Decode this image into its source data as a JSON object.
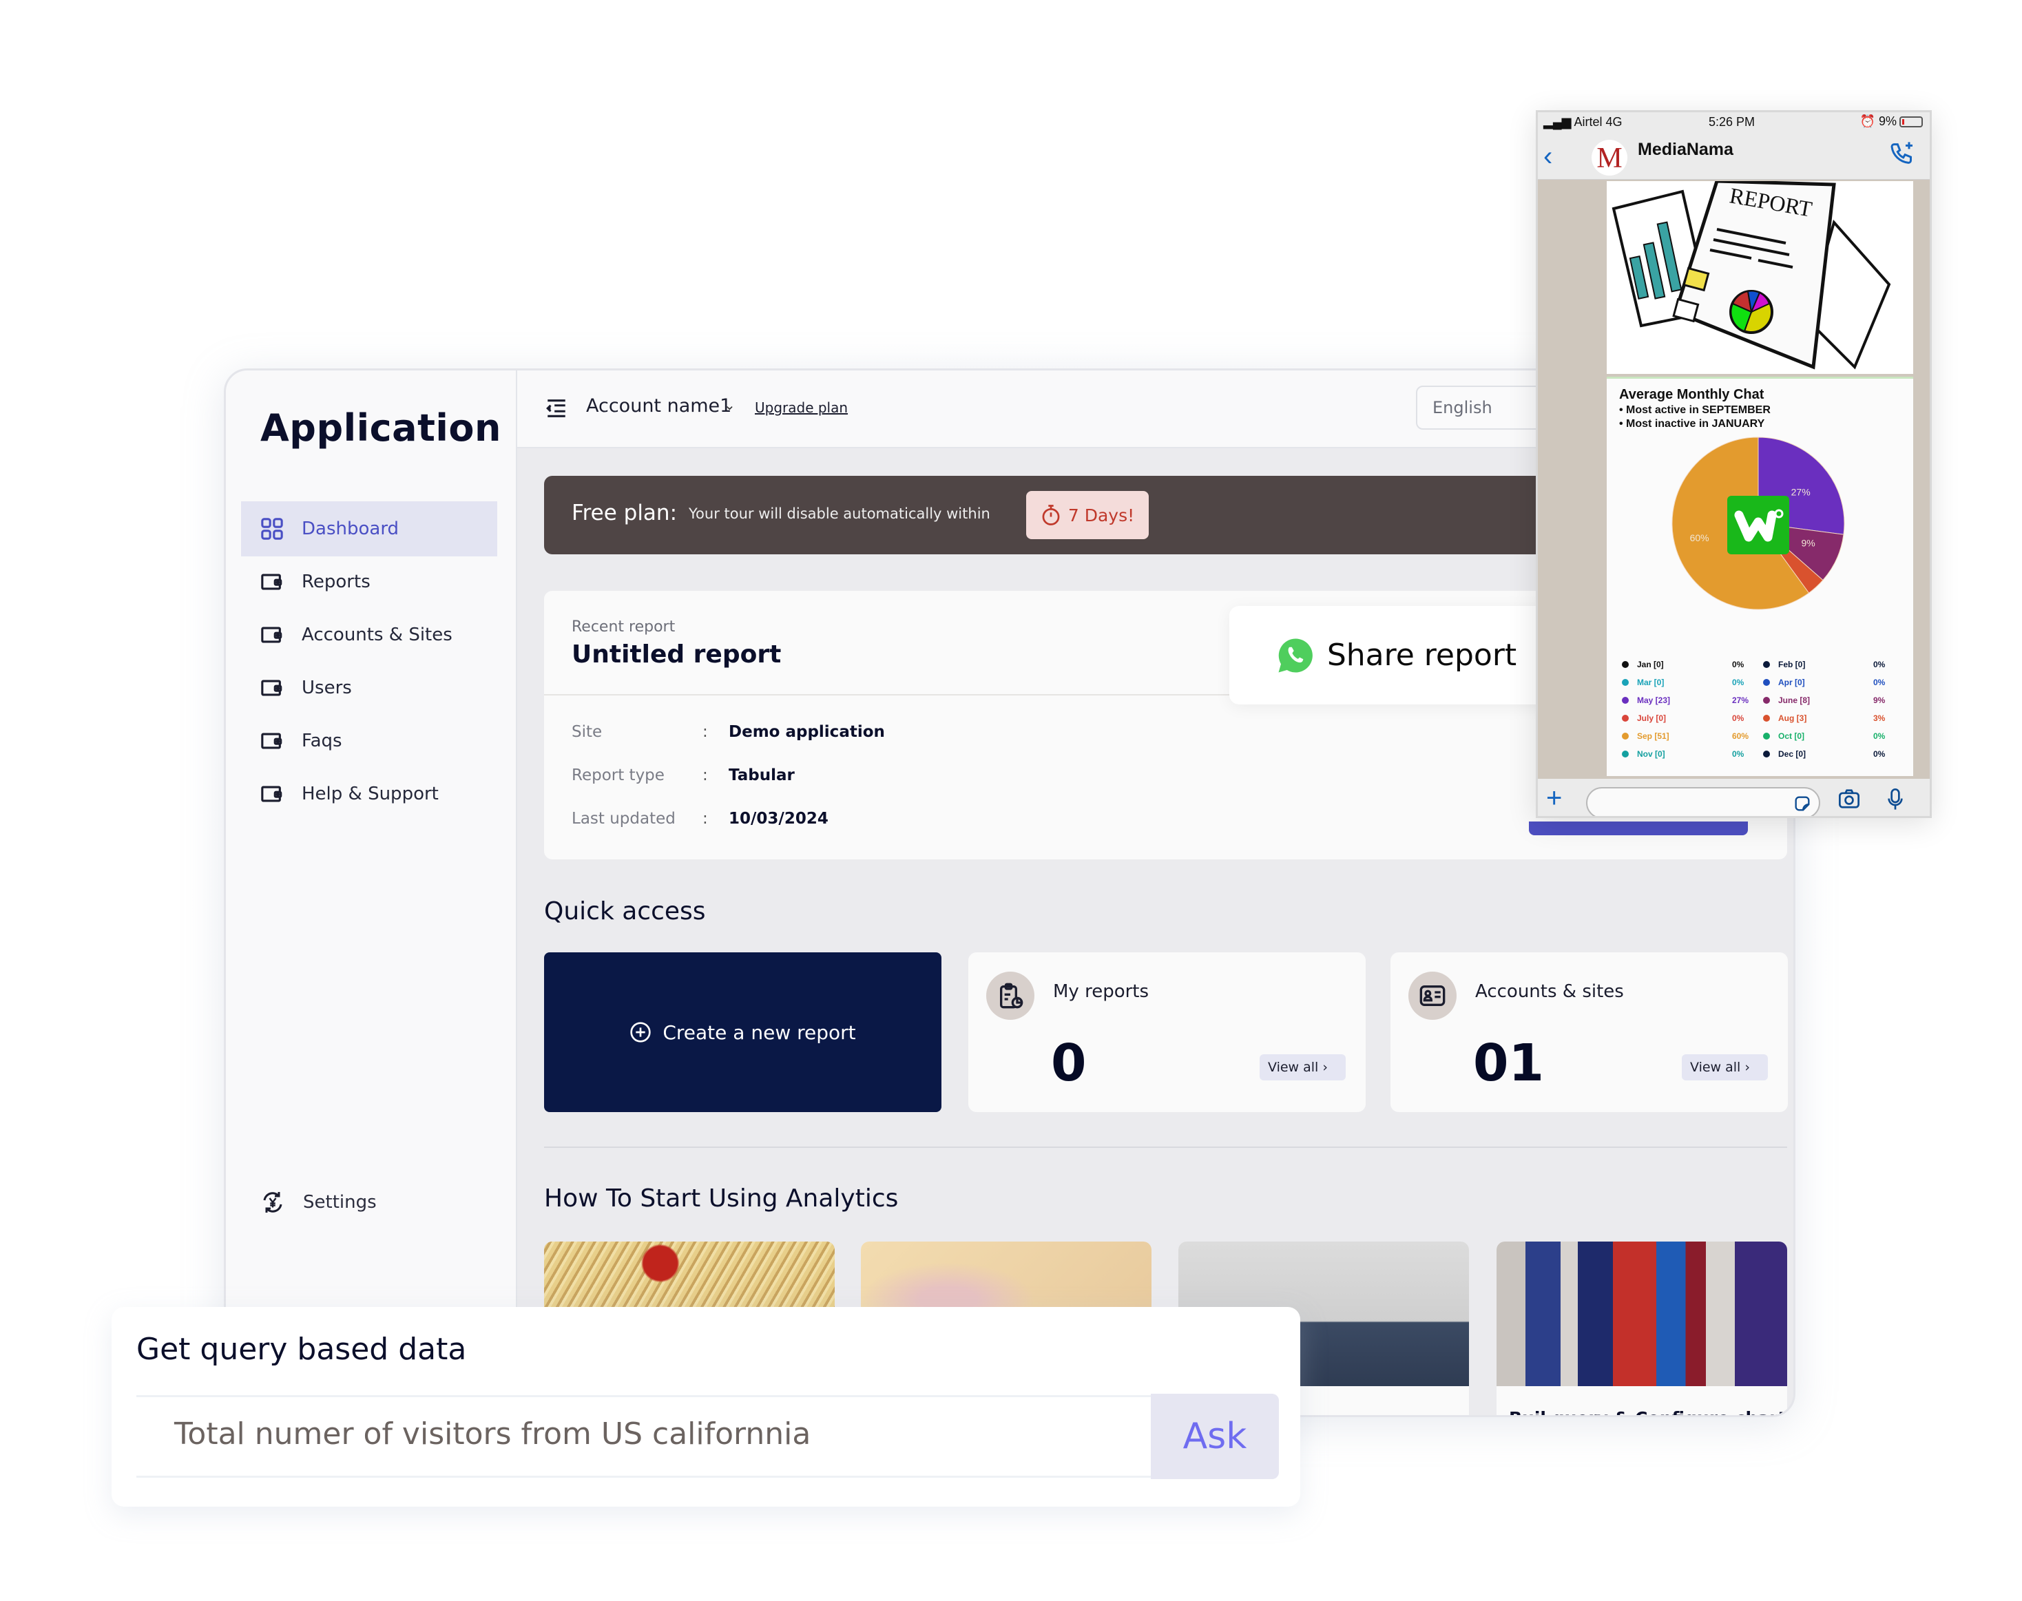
{
  "app": {
    "title": "Application",
    "sidebar": {
      "items": [
        {
          "label": "Dashboard",
          "icon": "grid-icon",
          "active": true
        },
        {
          "label": "Reports",
          "icon": "wallet-icon"
        },
        {
          "label": "Accounts & Sites",
          "icon": "wallet-icon"
        },
        {
          "label": "Users",
          "icon": "wallet-icon"
        },
        {
          "label": "Faqs",
          "icon": "wallet-icon"
        },
        {
          "label": "Help & Support",
          "icon": "wallet-icon"
        }
      ],
      "settings_label": "Settings"
    },
    "header": {
      "account_name": "Account name1",
      "upgrade_label": "Upgrade plan",
      "language": "English"
    },
    "banner": {
      "plan_label": "Free plan:",
      "message": "Your tour will disable automatically within",
      "days_badge": "7 Days!"
    },
    "recent_report": {
      "subtitle": "Recent report",
      "title": "Untitled report",
      "fields": [
        {
          "key": "Site",
          "value": "Demo application"
        },
        {
          "key": "Report type",
          "value": "Tabular"
        },
        {
          "key": "Last updated",
          "value": "10/03/2024"
        }
      ]
    },
    "quick_access": {
      "title": "Quick access",
      "create_label": "Create a new report",
      "cards": [
        {
          "title": "My reports",
          "count": "0",
          "view_all": "View all"
        },
        {
          "title": "Accounts & sites",
          "count": "01",
          "view_all": "View all"
        }
      ]
    },
    "how_to": {
      "title": "How To Start Using Analytics",
      "thumbnails": [
        {
          "caption": ""
        },
        {
          "caption": ""
        },
        {
          "caption": ""
        },
        {
          "caption": "Buil query & Configure chart"
        }
      ]
    }
  },
  "share_popup": {
    "label": "Share report"
  },
  "query_panel": {
    "title": "Get query based data",
    "input_value": "Total numer of visitors from US californnia",
    "ask_label": "Ask"
  },
  "phone": {
    "carrier": "Airtel 4G",
    "time": "5:26 PM",
    "battery": "9%",
    "chat_name": "MediaNama",
    "avatar_letter": "M",
    "image_caption": "REPORT",
    "card": {
      "title": "Average Monthly Chat",
      "bullets": [
        "• Most active in SEPTEMBER",
        "• Most inactive in JANUARY"
      ]
    }
  },
  "chart_data": {
    "type": "pie",
    "title": "Average Monthly Chat",
    "subtitle": [
      "Most active in SEPTEMBER",
      "Most inactive in JANUARY"
    ],
    "categories": [
      "Jan",
      "Feb",
      "Mar",
      "Apr",
      "May",
      "June",
      "July",
      "Aug",
      "Sep",
      "Oct",
      "Nov",
      "Dec"
    ],
    "counts": [
      0,
      0,
      0,
      0,
      23,
      8,
      0,
      3,
      51,
      0,
      0,
      0
    ],
    "percents": [
      "0%",
      "0%",
      "0%",
      "0%",
      "27%",
      "9%",
      "0%",
      "3%",
      "60%",
      "0%",
      "0%",
      "0%"
    ],
    "slice_labels": [
      "27%",
      "9%",
      "60%"
    ],
    "colors": [
      "#111111",
      "#0b1a3a",
      "#1aa3b8",
      "#1f4fbf",
      "#6a2fbf",
      "#862a6a",
      "#d9453a",
      "#d9522e",
      "#e39b2e",
      "#18b06a",
      "#14a0a0",
      "#0b1a3a"
    ],
    "legend": "bottom"
  }
}
